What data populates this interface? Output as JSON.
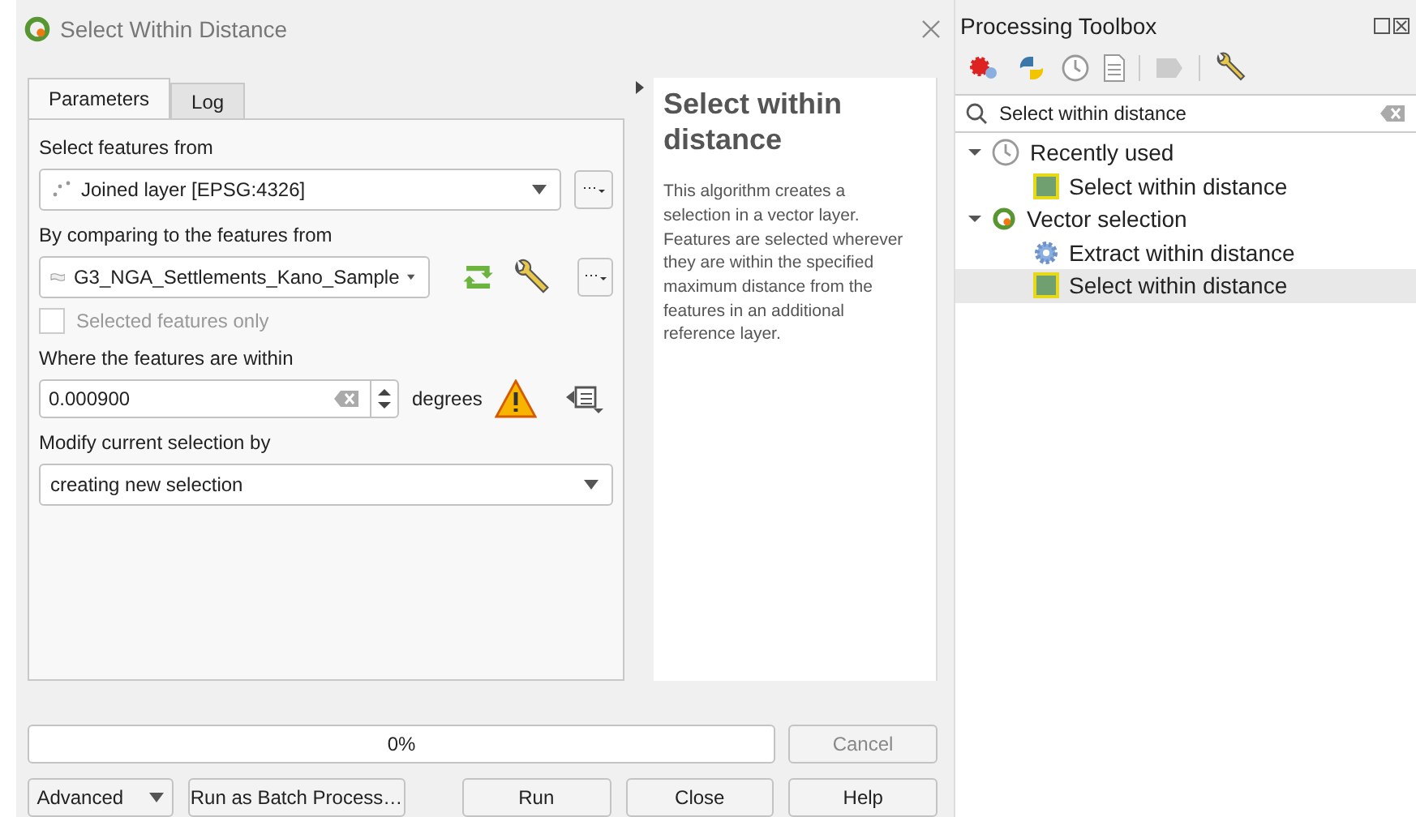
{
  "window": {
    "title": "Select Within Distance"
  },
  "tabs": [
    {
      "label": "Parameters",
      "selected": true
    },
    {
      "label": "Log",
      "selected": false
    }
  ],
  "params": [
    {
      "kind": "layer",
      "label": "Select features from",
      "value": "Joined layer [EPSG:4326]",
      "tools": false
    },
    {
      "kind": "layer",
      "label": "By comparing to the features from",
      "value": "G3_NGA_Settlements_Kano_Sample",
      "tools": true
    },
    {
      "kind": "checkbox",
      "text": "Selected features only",
      "checked": false,
      "disabled": true
    },
    {
      "kind": "distance",
      "label": "Where the features are within",
      "value": "0.000900",
      "unit": "degrees",
      "warning": true
    },
    {
      "kind": "enum",
      "label": "Modify current selection by",
      "value": "creating new selection"
    }
  ],
  "help": {
    "title": "Select within distance",
    "body": "This algorithm creates a selection in a vector layer. Features are selected wherever they are within the specified maximum distance from the features in an additional reference layer."
  },
  "progress": {
    "text": "0%",
    "level": 0,
    "cancel": {
      "label": "Cancel",
      "disabled": true
    }
  },
  "buttons": [
    {
      "label": "Advanced",
      "kind": "menu"
    },
    {
      "label": "Run as Batch Process…",
      "kind": "plain"
    },
    {
      "label": "Run",
      "kind": "plain"
    },
    {
      "label": "Close",
      "kind": "plain"
    },
    {
      "label": "Help",
      "kind": "plain"
    }
  ],
  "toolbox": {
    "title": "Processing Toolbox",
    "search": "Select within distance",
    "tree": [
      {
        "label": "Recently used",
        "kind": "history",
        "expanded": true,
        "children": [
          {
            "label": "Select within distance",
            "kind": "select",
            "selected": false
          }
        ]
      },
      {
        "label": "Vector selection",
        "kind": "provider",
        "expanded": true,
        "children": [
          {
            "label": "Extract within distance",
            "kind": "extract",
            "selected": false
          },
          {
            "label": "Select within distance",
            "kind": "select",
            "selected": true
          }
        ]
      }
    ]
  }
}
